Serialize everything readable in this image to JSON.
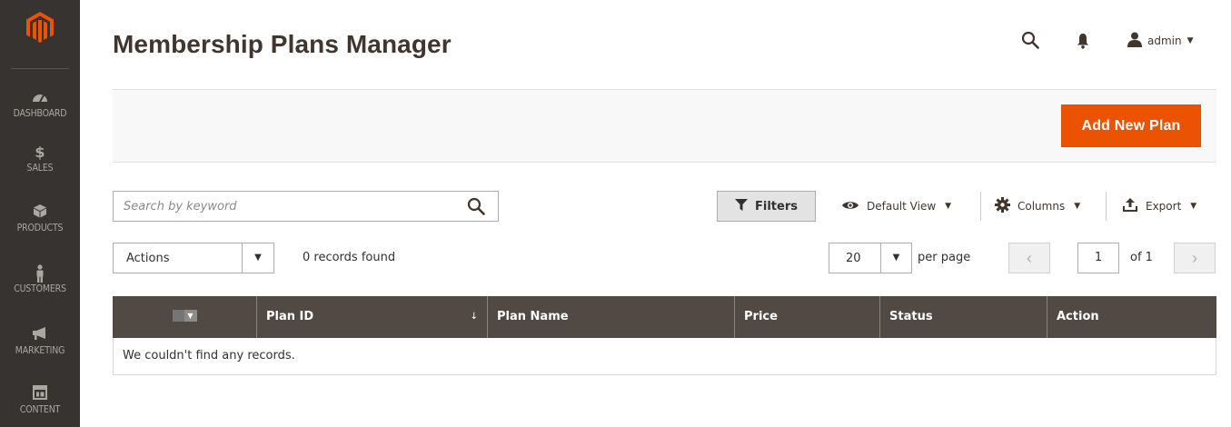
{
  "app": {
    "logo_icon": "magento-logo-icon",
    "accent_color": "#eb5202",
    "sidebar_color": "#373330"
  },
  "sidebar": {
    "items": [
      {
        "label": "DASHBOARD",
        "icon": "gauge-icon"
      },
      {
        "label": "SALES",
        "icon": "dollar-icon"
      },
      {
        "label": "PRODUCTS",
        "icon": "cube-icon"
      },
      {
        "label": "CUSTOMERS",
        "icon": "person-icon"
      },
      {
        "label": "MARKETING",
        "icon": "megaphone-icon"
      },
      {
        "label": "CONTENT",
        "icon": "layout-icon"
      }
    ]
  },
  "header": {
    "title": "Membership Plans Manager",
    "user": "admin"
  },
  "page_actions": {
    "add_label": "Add New Plan"
  },
  "toolbar": {
    "search_placeholder": "Search by keyword",
    "filters_label": "Filters",
    "view_label": "Default View",
    "columns_label": "Columns",
    "export_label": "Export",
    "actions_label": "Actions",
    "records_found": "0 records found",
    "per_page_value": "20",
    "per_page_label": "per page",
    "page_current": "1",
    "page_total_label": "of 1"
  },
  "grid": {
    "columns": [
      "Plan ID",
      "Plan Name",
      "Price",
      "Status",
      "Action"
    ],
    "sorted_column": "Plan ID",
    "sort_indicator": "↓",
    "empty_text": "We couldn't find any records."
  }
}
